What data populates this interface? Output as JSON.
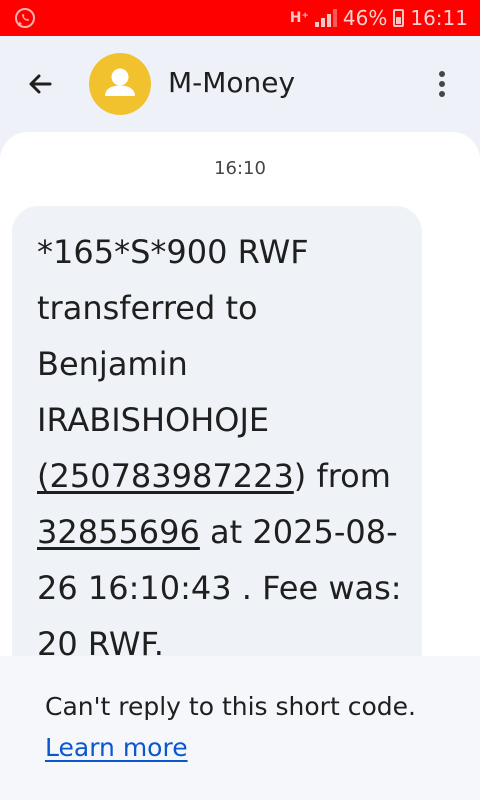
{
  "status_bar": {
    "network_type": "H⁺",
    "battery_percent": "46%",
    "time": "16:11",
    "notification_icon": "whatsapp-icon",
    "colors": {
      "background": "#ff0000"
    }
  },
  "app_bar": {
    "title": "M-Money",
    "back_icon": "back-arrow-icon",
    "more_icon": "more-vert-icon",
    "avatar_icon": "person-icon",
    "avatar_color": "#f2c12e"
  },
  "conversation": {
    "timestamp": "16:10",
    "message": {
      "part1": "*165*S*900 RWF transferred to Benjamin IRABISHOHOJE ",
      "phone_link": "(250783987223",
      "part2": ") from ",
      "account_link": "32855696",
      "part3": " at 2025-08-26 16:10:43 . Fee was: 20 RWF."
    }
  },
  "footer": {
    "notice": "Can't reply to this short code.",
    "learn_more": "Learn more",
    "link_color": "#0b57d0"
  }
}
